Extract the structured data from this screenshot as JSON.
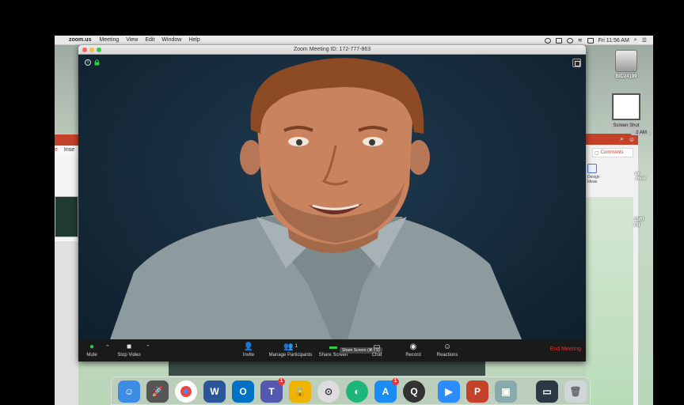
{
  "menubar": {
    "app_name": "zoom.us",
    "items": [
      "Meeting",
      "View",
      "Edit",
      "Window",
      "Help"
    ],
    "clock": "Fri 11:56 AM"
  },
  "zoom_window": {
    "title": "Zoom Meeting ID: 172-777-863"
  },
  "toolbar": {
    "mute_label": "Mute",
    "stop_video_label": "Stop Video",
    "invite_label": "Invite",
    "participants_label": "Manage Participants",
    "participants_count": "1",
    "share_label": "Share Screen",
    "share_tooltip": "Share Screen (⌘⇧S)",
    "chat_label": "Chat",
    "record_label": "Record",
    "reactions_label": "Reactions",
    "end_label": "End Meeting"
  },
  "desktop": {
    "drive_label": "BID24199",
    "screenshot_label": "Screen Shot",
    "screenshot_time": "2 AM",
    "mov_label": "ur\n.mov",
    "jpg_label": "2bf0\npg"
  },
  "ppt": {
    "tab_home": "e",
    "tab_insert": "Inse",
    "comments_label": "Comments",
    "design_ideas_label": "Design Ideas",
    "slide_text": "title"
  },
  "dock": {
    "teams_badge": "1",
    "appstore_badge": "1"
  },
  "colors": {
    "zoom_bg": "#1a1a1a",
    "end_meeting": "#e0322f",
    "ppt_red": "#c5422a",
    "video_bg": "#162b3c"
  }
}
